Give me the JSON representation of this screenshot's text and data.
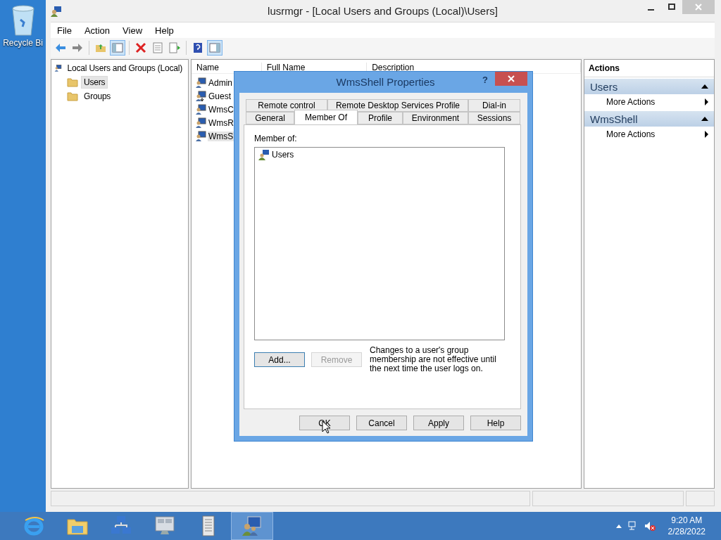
{
  "desktop": {
    "icons": [
      {
        "label": "Recycle Bi"
      }
    ]
  },
  "window": {
    "title": "lusrmgr - [Local Users and Groups (Local)\\Users]",
    "menu": [
      "File",
      "Action",
      "View",
      "Help"
    ],
    "toolbar": [
      {
        "kind": "back",
        "pressed": false
      },
      {
        "kind": "forward",
        "pressed": false
      },
      {
        "kind": "sep"
      },
      {
        "kind": "up",
        "pressed": false
      },
      {
        "kind": "tree",
        "pressed": true
      },
      {
        "kind": "sep"
      },
      {
        "kind": "delete",
        "pressed": false
      },
      {
        "kind": "properties",
        "pressed": false
      },
      {
        "kind": "export",
        "pressed": false
      },
      {
        "kind": "sep"
      },
      {
        "kind": "help",
        "pressed": false
      },
      {
        "kind": "pane",
        "pressed": true
      }
    ],
    "tree": {
      "label": "Local Users and Groups (Local)",
      "children": [
        {
          "label": "Users",
          "selected": true
        },
        {
          "label": "Groups",
          "selected": false
        }
      ]
    },
    "list": {
      "columns": [
        "Name",
        "Full Name",
        "Description"
      ],
      "rows": [
        {
          "name": "Admin",
          "kind": "user"
        },
        {
          "name": "Guest",
          "kind": "disabled-user"
        },
        {
          "name": "WmsC",
          "kind": "user"
        },
        {
          "name": "WmsR",
          "kind": "user"
        },
        {
          "name": "WmsS",
          "kind": "user",
          "selected": true
        }
      ]
    },
    "actions": {
      "title": "Actions",
      "sections": [
        {
          "title": "Users",
          "items": [
            "More Actions"
          ]
        },
        {
          "title": "WmsShell",
          "items": [
            "More Actions"
          ]
        }
      ]
    }
  },
  "dialog": {
    "title": "WmsShell Properties",
    "help": "?",
    "tab_rows": [
      [
        {
          "label": "Remote control",
          "selected": false
        },
        {
          "label": "Remote Desktop Services Profile",
          "selected": false
        },
        {
          "label": "Dial-in",
          "selected": false
        }
      ],
      [
        {
          "label": "General",
          "selected": false
        },
        {
          "label": "Member Of",
          "selected": true
        },
        {
          "label": "Profile",
          "selected": false
        },
        {
          "label": "Environment",
          "selected": false
        },
        {
          "label": "Sessions",
          "selected": false
        }
      ]
    ],
    "member_label": "Member of:",
    "members": [
      "Users"
    ],
    "buttons": [
      {
        "label": "Add...",
        "disabled": false,
        "focused": true
      },
      {
        "label": "Remove",
        "disabled": true,
        "focused": false
      }
    ],
    "note": "Changes to a user's group membership are not effective until the next time the user logs on.",
    "footer": [
      {
        "label": "OK"
      },
      {
        "label": "Cancel"
      },
      {
        "label": "Apply"
      },
      {
        "label": "Help"
      }
    ]
  },
  "taskbar": {
    "items": [
      {
        "kind": "browser",
        "selected": false
      },
      {
        "kind": "folder",
        "selected": false
      },
      {
        "kind": "network",
        "selected": false
      },
      {
        "kind": "monitor",
        "selected": false
      },
      {
        "kind": "notepad",
        "selected": false
      },
      {
        "kind": "users",
        "selected": true
      }
    ],
    "tray": {
      "time": "9:20 AM",
      "date": "2/28/2022"
    }
  }
}
